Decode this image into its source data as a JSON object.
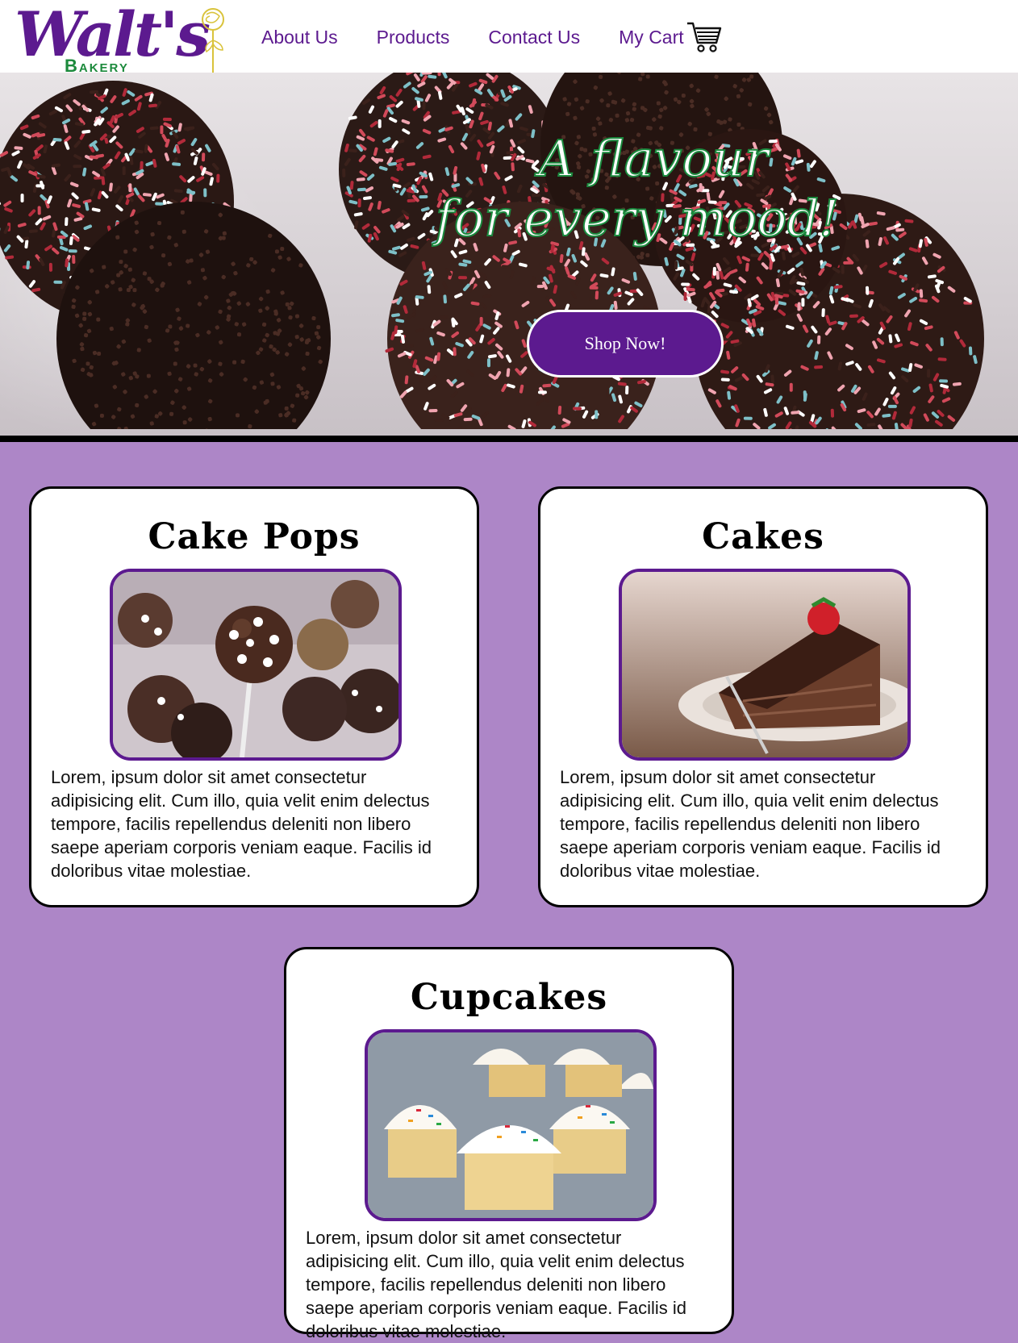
{
  "logo": {
    "name": "Walt's",
    "sub": "Bakery"
  },
  "nav": {
    "items": [
      "About Us",
      "Products",
      "Contact Us"
    ],
    "cart_label": "My Cart",
    "cart_icon": "shopping-cart-icon"
  },
  "hero": {
    "tagline_line1": "A flavour",
    "tagline_line2": "for every mood!",
    "cta_label": "Shop Now!"
  },
  "products": [
    {
      "title": "Cake Pops",
      "text": "Lorem, ipsum dolor sit amet consectetur adipisicing elit. Cum illo, quia velit enim delectus tempore, facilis repellendus deleniti non libero saepe aperiam corporis veniam eaque. Facilis id doloribus vitae molestiae."
    },
    {
      "title": "Cakes",
      "text": "Lorem, ipsum dolor sit amet consectetur adipisicing elit. Cum illo, quia velit enim delectus tempore, facilis repellendus deleniti non libero saepe aperiam corporis veniam eaque. Facilis id doloribus vitae molestiae."
    },
    {
      "title": "Cupcakes",
      "text": "Lorem, ipsum dolor sit amet consectetur adipisicing elit. Cum illo, quia velit enim delectus tempore, facilis repellendus deleniti non libero saepe aperiam corporis veniam eaque. Facilis id doloribus vitae molestiae."
    }
  ],
  "colors": {
    "brand_purple": "#5c1a8f",
    "brand_green": "#1c8a3c",
    "page_background": "#ad86c7"
  }
}
